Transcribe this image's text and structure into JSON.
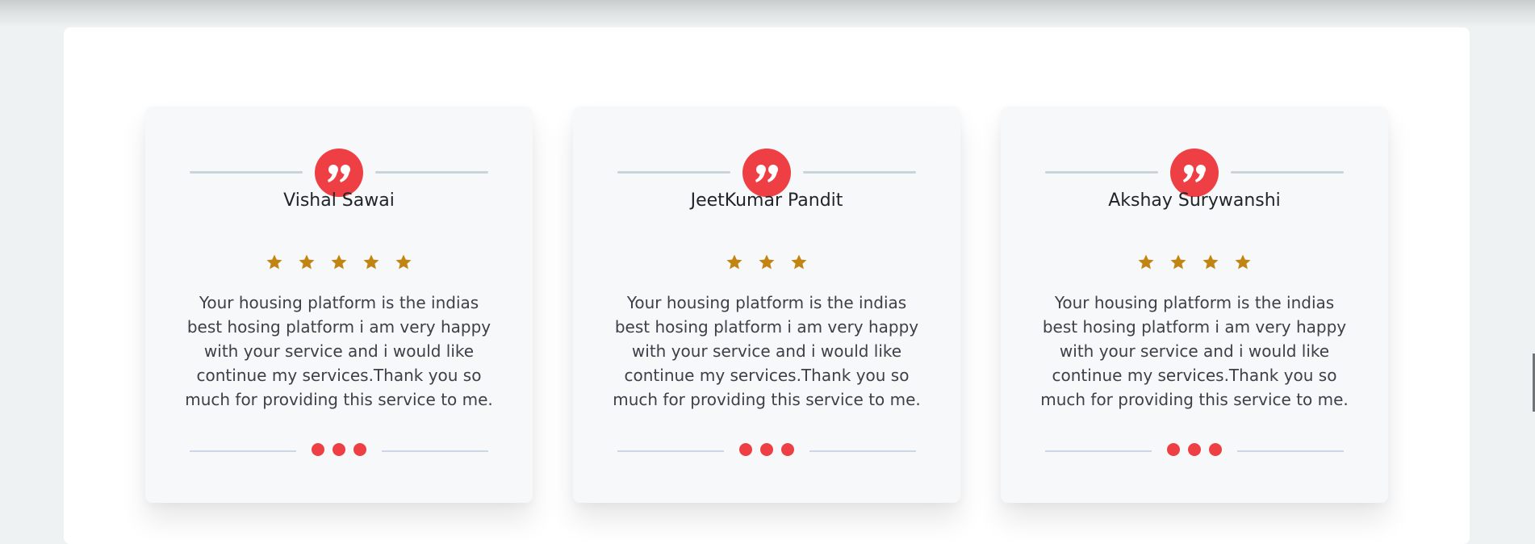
{
  "theme": {
    "accent": "#ee4044",
    "star_color": "#c28412",
    "card_bg": "#f7f8fa",
    "text_color": "#3b4147"
  },
  "testimonials": [
    {
      "name": "Vishal Sawai",
      "rating": 5,
      "text": "Your housing platform is the indias best hosing platform i am very happy with your service and i would like continue my services.Thank you so much for providing this service to me."
    },
    {
      "name": "JeetKumar Pandit",
      "rating": 3,
      "text": "Your housing platform is the indias best hosing platform i am very happy with your service and i would like continue my services.Thank you so much for providing this service to me."
    },
    {
      "name": "Akshay Surywanshi",
      "rating": 4,
      "text": "Your housing platform is the indias best hosing platform i am very happy with your service and i would like continue my services.Thank you so much for providing this service to me."
    }
  ],
  "icons": {
    "quote": "quote-icon",
    "star": "star-icon",
    "dot": "dot-icon"
  }
}
